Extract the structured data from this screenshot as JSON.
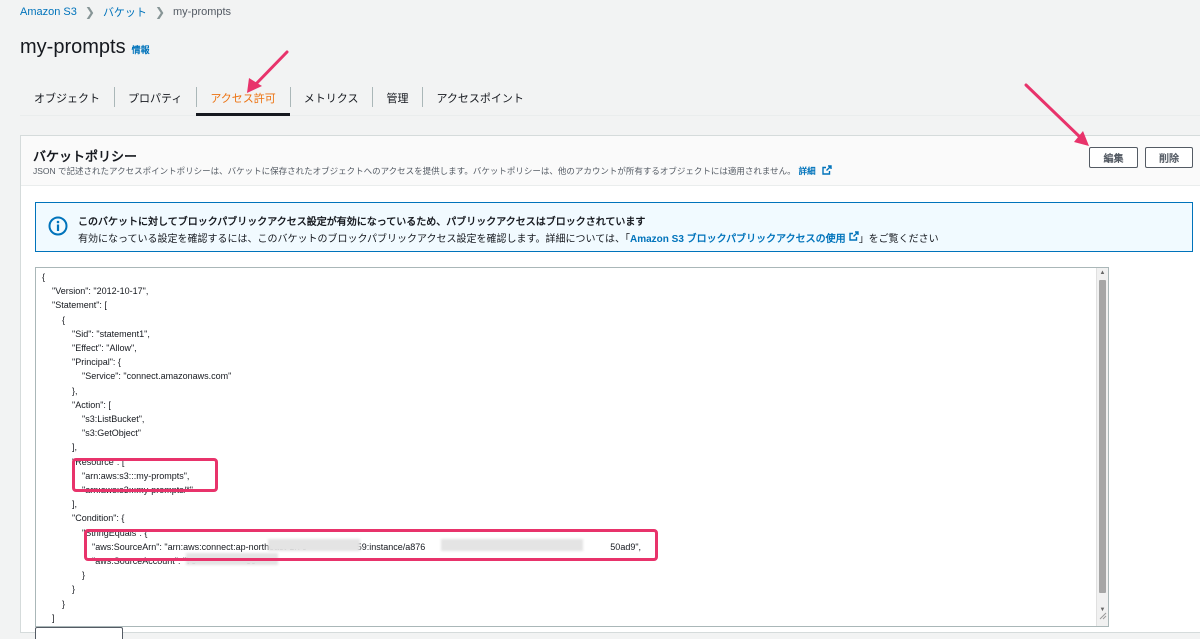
{
  "breadcrumb": {
    "items": [
      "Amazon S3",
      "バケット",
      "my-prompts"
    ]
  },
  "page": {
    "title": "my-prompts",
    "info_label": "情報"
  },
  "tabs": [
    {
      "label": "オブジェクト",
      "active": false
    },
    {
      "label": "プロパティ",
      "active": false
    },
    {
      "label": "アクセス許可",
      "active": true
    },
    {
      "label": "メトリクス",
      "active": false
    },
    {
      "label": "管理",
      "active": false
    },
    {
      "label": "アクセスポイント",
      "active": false
    }
  ],
  "policy": {
    "title": "バケットポリシー",
    "description": "JSON で記述されたアクセスポイントポリシーは、バケットに保存されたオブジェクトへのアクセスを提供します。バケットポリシーは、他のアカウントが所有するオブジェクトには適用されません。",
    "details_link": "詳細",
    "edit_label": "編集",
    "delete_label": "削除"
  },
  "alert": {
    "title": "このバケットに対してブロックパブリックアクセス設定が有効になっているため、パブリックアクセスはブロックされています",
    "body_prefix": "有効になっている設定を確認するには、このバケットのブロックパブリックアクセス設定を確認します。詳細については、「",
    "link": "Amazon S3 ブロックパブリックアクセスの使用",
    "body_suffix": "」をご覧ください"
  },
  "editor": {
    "lines": [
      "{",
      "    \"Version\": \"2012-10-17\",",
      "    \"Statement\": [",
      "        {",
      "            \"Sid\": \"statement1\",",
      "            \"Effect\": \"Allow\",",
      "            \"Principal\": {",
      "                \"Service\": \"connect.amazonaws.com\"",
      "            },",
      "            \"Action\": [",
      "                \"s3:ListBucket\",",
      "                \"s3:GetObject\"",
      "            ],",
      "            \"Resource\": [",
      "                \"arn:aws:s3:::my-prompts\",",
      "                \"arn:aws:s3:::my-prompts/*\"",
      "            ],",
      "            \"Condition\": {",
      "                \"StringEquals\": {",
      "                    \"aws:SourceArn\": \"arn:aws:connect:ap-northeast-1:76                    59:instance/a876                                                                          50ad9\",",
      "                    \"aws:SourceAccount\": \"76                    59\"",
      "                }",
      "            }",
      "        }",
      "    ]",
      "}"
    ]
  },
  "colors": {
    "accent": "#ec7211",
    "link": "#0073bb",
    "annotation": "#e8336b",
    "alert_border": "#0073bb",
    "alert_bg": "#f1faff"
  },
  "icons": {
    "alert": "info-circle-icon",
    "external": "external-link-icon",
    "breadcrumb_separator": "chevron-right-icon"
  }
}
